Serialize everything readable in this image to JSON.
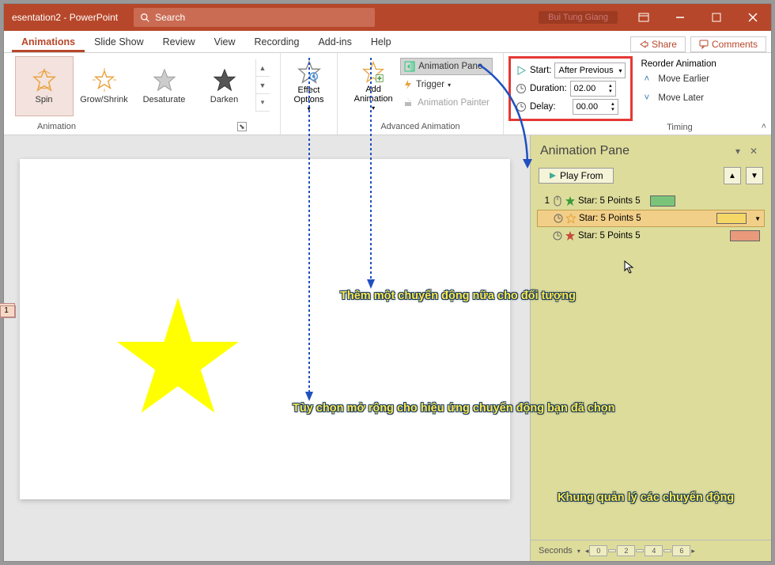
{
  "titlebar": {
    "title": "esentation2 - PowerPoint",
    "search_placeholder": "Search",
    "user": "Bui Tung Giang"
  },
  "tabs": {
    "t0": "",
    "t1": "Animations",
    "t2": "Slide Show",
    "t3": "Review",
    "t4": "View",
    "t5": "Recording",
    "t6": "Add-ins",
    "t7": "Help",
    "share": "Share",
    "comments": "Comments"
  },
  "ribbon": {
    "gallery": {
      "spin": "Spin",
      "grow": "Grow/Shrink",
      "desat": "Desaturate",
      "darken": "Darken"
    },
    "group_anim": "Animation",
    "effect_options": "Effect\nOptions",
    "add_anim": "Add\nAnimation",
    "anim_pane": "Animation Pane",
    "trigger": "Trigger",
    "painter": "Animation Painter",
    "group_adv": "Advanced Animation",
    "start": "Start:",
    "start_val": "After Previous",
    "duration": "Duration:",
    "duration_val": "02.00",
    "delay": "Delay:",
    "delay_val": "00.00",
    "reorder": "Reorder Animation",
    "earlier": "Move Earlier",
    "later": "Move Later",
    "group_timing": "Timing"
  },
  "slide": {
    "badge": "1"
  },
  "anim_pane": {
    "title": "Animation Pane",
    "play": "Play From",
    "item_prefix": "1",
    "item_label": "Star: 5 Points 5",
    "seconds": "Seconds",
    "ruler": [
      "0",
      "",
      "2",
      "",
      "4",
      "",
      "6"
    ]
  },
  "callouts": {
    "c1": "Thêm một chuyển động nữa cho đối tượng",
    "c2": "Tùy chọn mở rộng cho hiệu ứng chuyển động bạn đã chọn",
    "c3": "Khung quản lý các chuyển động"
  }
}
